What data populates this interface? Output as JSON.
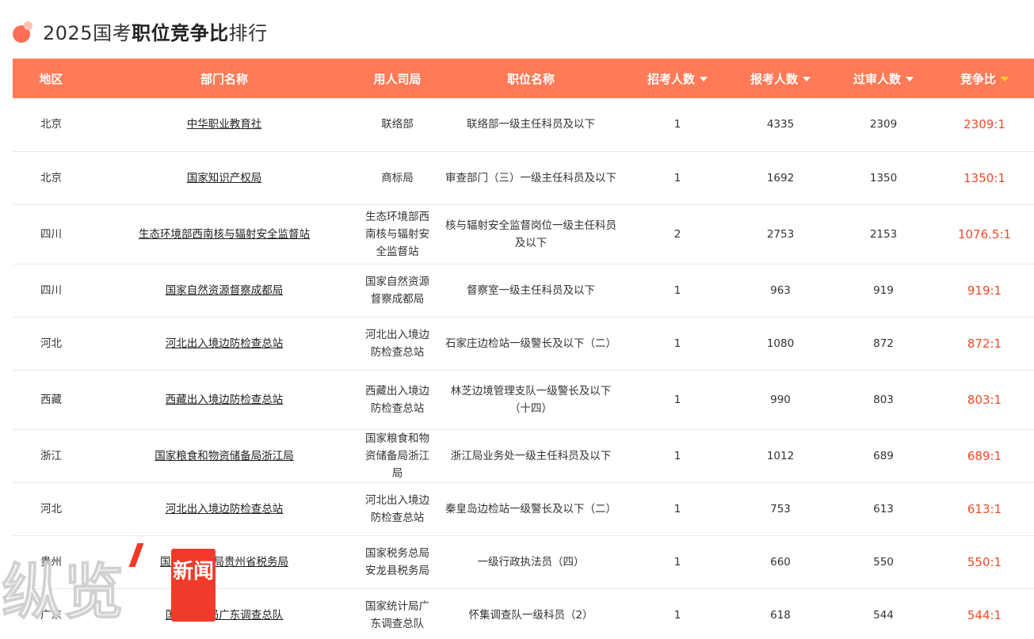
{
  "header": {
    "title_prefix": "2025国考",
    "title_bold": "职位竞争比",
    "title_suffix": "排行"
  },
  "table": {
    "columns": [
      "地区",
      "部门名称",
      "用人司局",
      "职位名称",
      "招考人数",
      "报考人数",
      "过审人数",
      "竞争比"
    ],
    "rows": [
      {
        "region": "北京",
        "dept": "中华职业教育社",
        "bureau": "联络部",
        "position": "联络部一级主任科员及以下",
        "hire": "1",
        "applied": "4335",
        "passed": "2309",
        "ratio": "2309:1"
      },
      {
        "region": "北京",
        "dept": "国家知识产权局",
        "bureau": "商标局",
        "position": "审查部门（三）一级主任科员及以下",
        "hire": "1",
        "applied": "1692",
        "passed": "1350",
        "ratio": "1350:1"
      },
      {
        "region": "四川",
        "dept": "生态环境部西南核与辐射安全监督站",
        "bureau": "生态环境部西南核与辐射安全监督站",
        "position": "核与辐射安全监督岗位一级主任科员及以下",
        "hire": "2",
        "applied": "2753",
        "passed": "2153",
        "ratio": "1076.5:1"
      },
      {
        "region": "四川",
        "dept": "国家自然资源督察成都局",
        "bureau": "国家自然资源督察成都局",
        "position": "督察室一级主任科员及以下",
        "hire": "1",
        "applied": "963",
        "passed": "919",
        "ratio": "919:1"
      },
      {
        "region": "河北",
        "dept": "河北出入境边防检查总站",
        "bureau": "河北出入境边防检查总站",
        "position": "石家庄边检站一级警长及以下（二）",
        "hire": "1",
        "applied": "1080",
        "passed": "872",
        "ratio": "872:1"
      },
      {
        "region": "西藏",
        "dept": "西藏出入境边防检查总站",
        "bureau": "西藏出入境边防检查总站",
        "position": "林芝边境管理支队一级警长及以下（十四）",
        "hire": "1",
        "applied": "990",
        "passed": "803",
        "ratio": "803:1"
      },
      {
        "region": "浙江",
        "dept": "国家粮食和物资储备局浙江局",
        "bureau": "国家粮食和物资储备局浙江局",
        "position": "浙江局业务处一级主任科员及以下",
        "hire": "1",
        "applied": "1012",
        "passed": "689",
        "ratio": "689:1"
      },
      {
        "region": "河北",
        "dept": "河北出入境边防检查总站",
        "bureau": "河北出入境边防检查总站",
        "position": "秦皇岛边检站一级警长及以下（二）",
        "hire": "1",
        "applied": "753",
        "passed": "613",
        "ratio": "613:1"
      },
      {
        "region": "贵州",
        "dept": "国家税务总局贵州省税务局",
        "bureau": "国家税务总局安龙县税务局",
        "position": "一级行政执法员（四）",
        "hire": "1",
        "applied": "660",
        "passed": "550",
        "ratio": "550:1"
      },
      {
        "region": "广东",
        "dept": "国家统计局广东调查总队",
        "bureau": "国家统计局广东调查总队",
        "position": "怀集调查队一级科员（2）",
        "hire": "1",
        "applied": "618",
        "passed": "544",
        "ratio": "544:1"
      }
    ]
  },
  "watermark": {
    "brand": "纵览",
    "badge": "新闻"
  },
  "colors": {
    "header_bg": "#ff7a57",
    "ratio_text": "#f04a2a",
    "active_sort": "#ffd21f",
    "badge_red": "#f23a2a"
  }
}
